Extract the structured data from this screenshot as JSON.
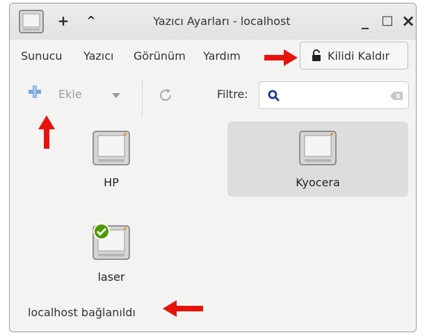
{
  "window": {
    "title": "Yazıcı Ayarları - localhost",
    "controls": {
      "pin": "+",
      "up": "^",
      "minimize": "_",
      "maximize": "□",
      "close": "×"
    }
  },
  "menubar": {
    "items": [
      {
        "label": "Sunucu"
      },
      {
        "label": "Yazıcı"
      },
      {
        "label": "Görünüm"
      },
      {
        "label": "Yardım"
      }
    ],
    "unlock_label": "Kilidi Kaldır"
  },
  "toolbar": {
    "add_label": "Ekle",
    "filter_label": "Filtre:",
    "filter_value": "",
    "filter_placeholder": ""
  },
  "printers": [
    {
      "name": "HP",
      "selected": false,
      "default": false
    },
    {
      "name": "Kyocera",
      "selected": true,
      "default": false
    },
    {
      "name": "laser",
      "selected": false,
      "default": true
    }
  ],
  "statusbar": {
    "text": "localhost bağlanıldı"
  },
  "colors": {
    "annotation_arrow": "#e8120c",
    "selection": "#dcdddf",
    "add_icon": "#5b8fd6"
  }
}
